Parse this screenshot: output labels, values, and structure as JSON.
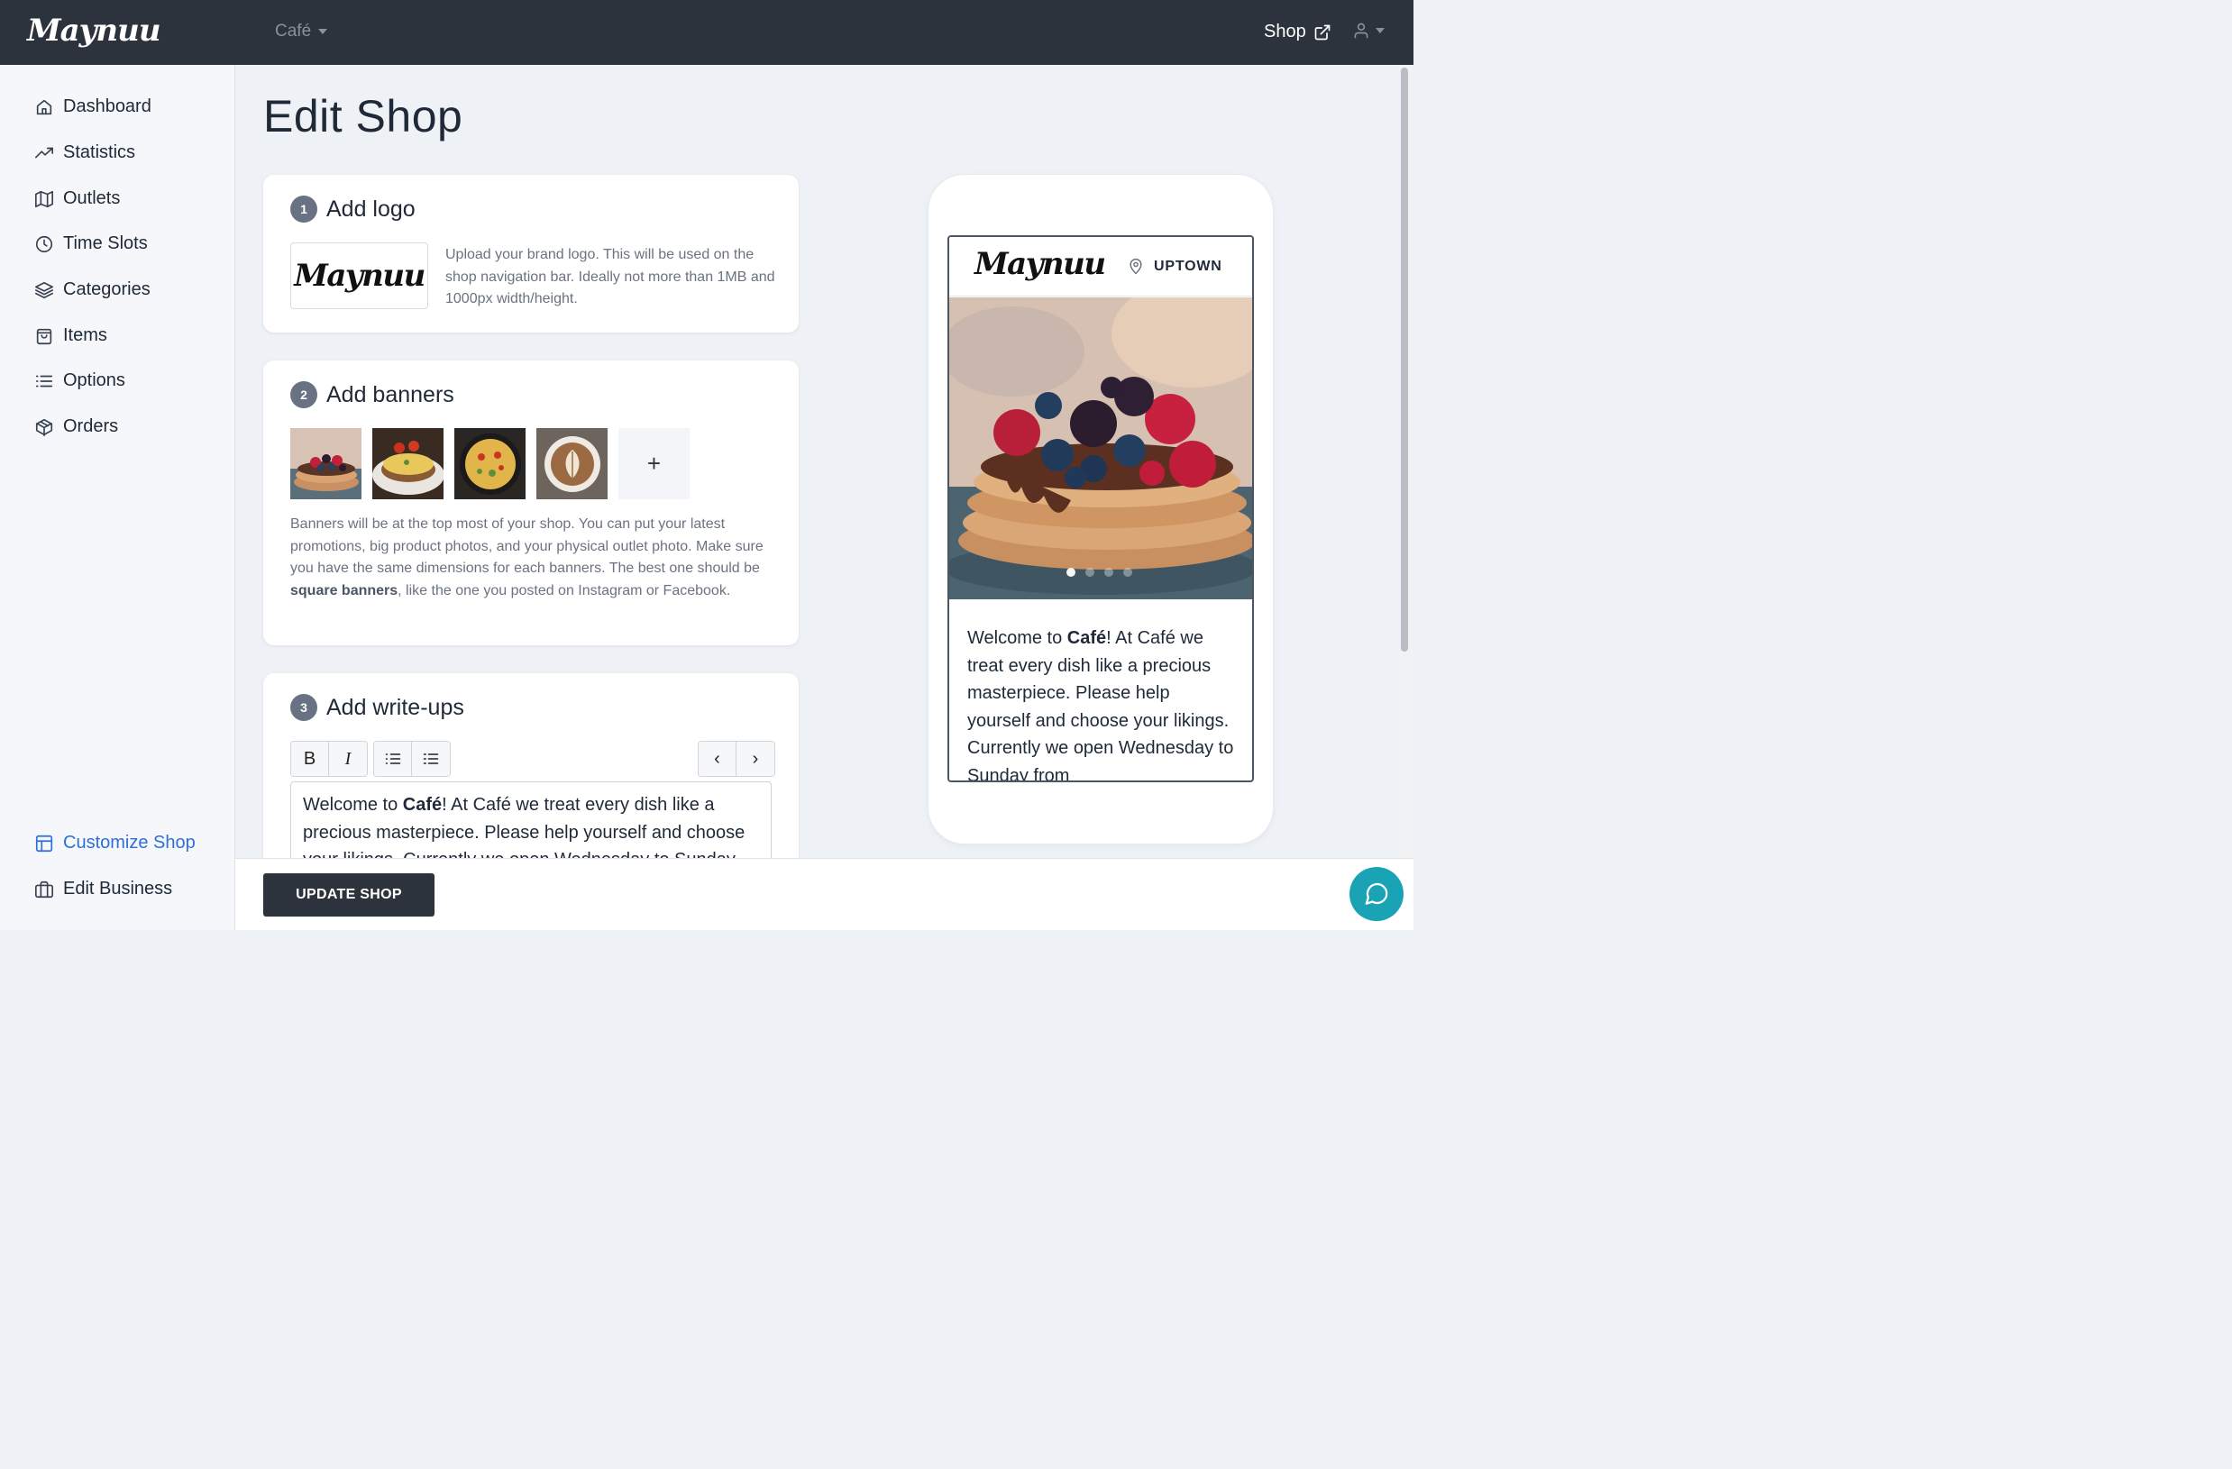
{
  "topbar": {
    "brand": "Maynuu",
    "shop_switcher": "Café",
    "shop_link": "Shop"
  },
  "sidebar": {
    "items": [
      {
        "label": "Dashboard",
        "icon": "home-icon"
      },
      {
        "label": "Statistics",
        "icon": "trending-up-icon"
      },
      {
        "label": "Outlets",
        "icon": "map-icon"
      },
      {
        "label": "Time Slots",
        "icon": "clock-icon"
      },
      {
        "label": "Categories",
        "icon": "layers-icon"
      },
      {
        "label": "Items",
        "icon": "shopping-bag-icon"
      },
      {
        "label": "Options",
        "icon": "list-icon"
      },
      {
        "label": "Orders",
        "icon": "package-icon"
      }
    ],
    "bottom_items": [
      {
        "label": "Customize Shop",
        "icon": "layout-icon",
        "active": true
      },
      {
        "label": "Edit Business",
        "icon": "briefcase-icon"
      }
    ]
  },
  "main": {
    "title": "Edit Shop",
    "logo_card": {
      "step": "1",
      "title": "Add logo",
      "logo_text": "Maynuu",
      "help": "Upload your brand logo. This will be used on the shop navigation bar. Ideally not more than 1MB and 1000px width/height."
    },
    "banners_card": {
      "step": "2",
      "title": "Add banners",
      "thumbnails": [
        "pancakes with berries",
        "omelette toast",
        "frittata skillet",
        "latte art"
      ],
      "add_label": "+",
      "help_before": "Banners will be at the top most of your shop. You can put your latest promotions, big product photos, and your physical outlet photo. Make sure you have the same dimensions for each banners. The best one should be ",
      "help_bold": "square banners",
      "help_after": ", like the one you posted on Instagram or Facebook."
    },
    "writeups_card": {
      "step": "3",
      "title": "Add write-ups",
      "toolbar": {
        "bold": "B",
        "italic": "I",
        "prev": "‹",
        "next": "›"
      },
      "text_before": "Welcome to ",
      "text_bold": "Café",
      "text_after": "! At Café we treat every dish like a precious masterpiece. Please help yourself and choose your likings. Currently we open Wednesday to Sunday from"
    }
  },
  "preview": {
    "brand": "Maynuu",
    "outlet": "UPTOWN",
    "banner_count": 4,
    "banner_active": 1,
    "text_before": "Welcome to ",
    "text_bold": "Café",
    "text_after": "! At Café we treat every dish like a precious masterpiece. Please help yourself and choose your likings. Currently we open Wednesday to Sunday from"
  },
  "footer": {
    "update_label": "UPDATE SHOP"
  },
  "colors": {
    "topbar": "#2d333d",
    "accent": "#2f6fd8",
    "chat": "#1aa3b4",
    "background": "#eef2f6"
  }
}
